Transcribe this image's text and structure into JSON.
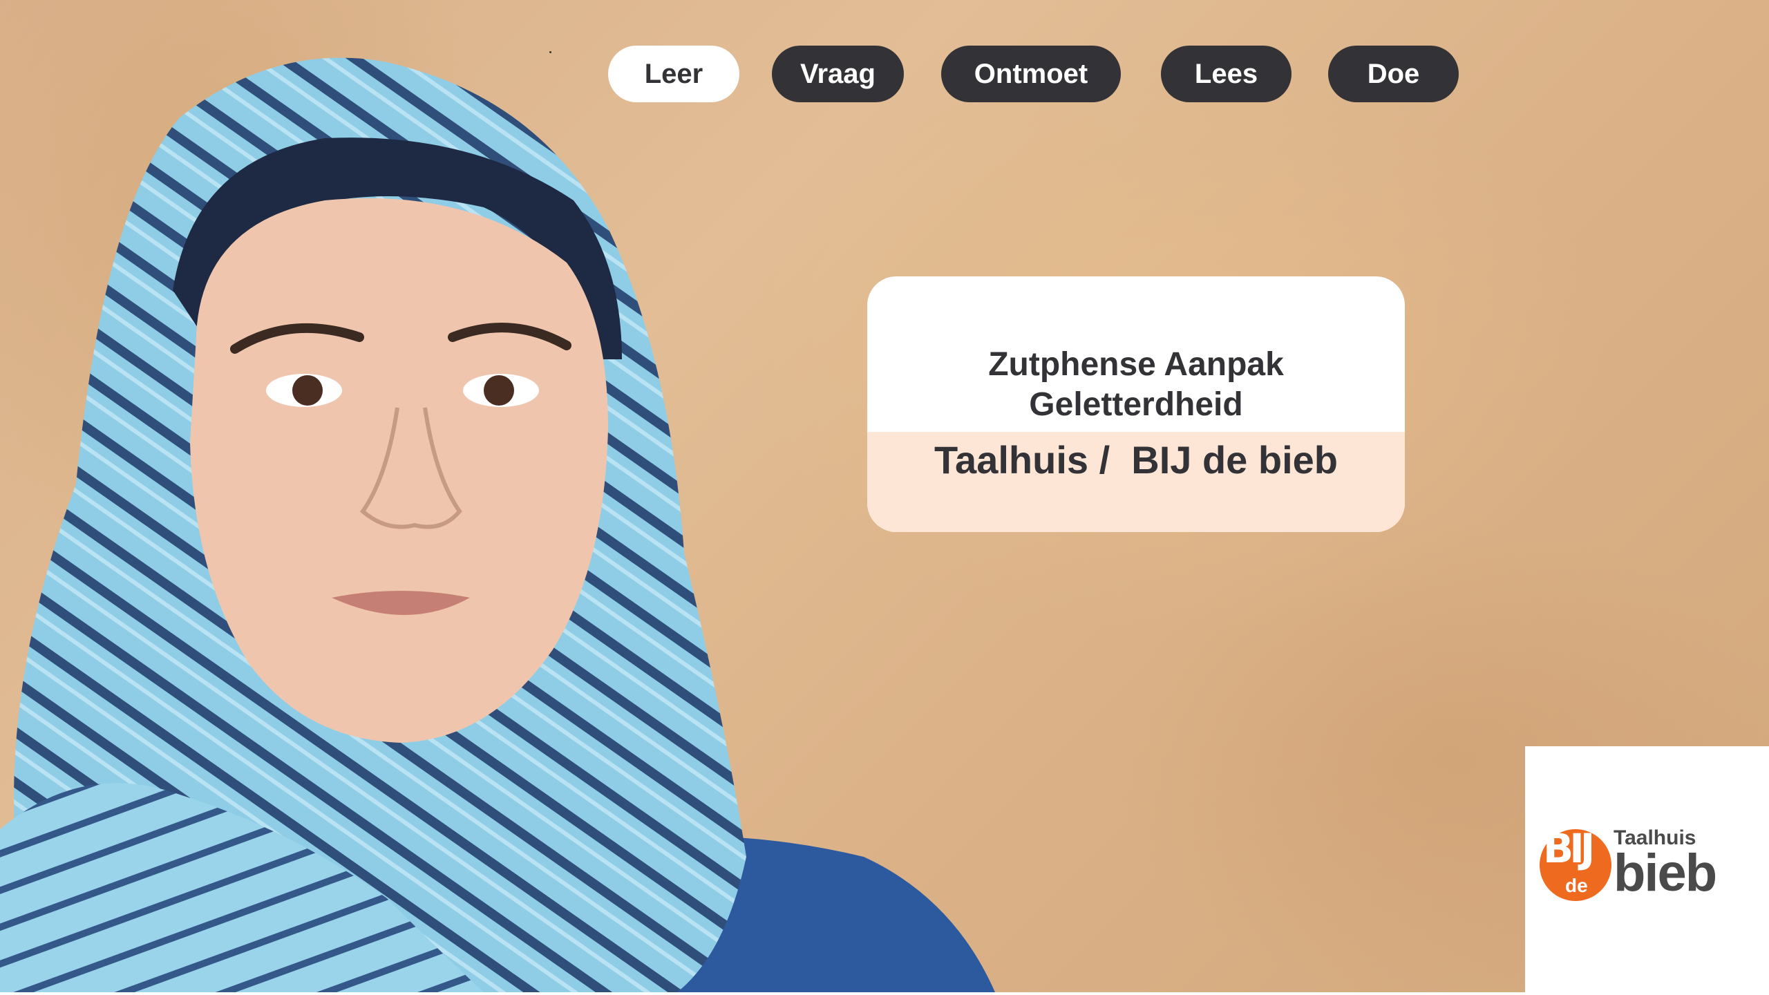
{
  "nav": {
    "items": [
      {
        "label": "Leer",
        "active": true
      },
      {
        "label": "Vraag",
        "active": false
      },
      {
        "label": "Ontmoet",
        "active": false
      },
      {
        "label": "Lees",
        "active": false
      },
      {
        "label": "Doe",
        "active": false
      }
    ]
  },
  "card": {
    "title_line1": "Zutphense Aanpak",
    "title_line2": "Geletterdheid",
    "subtitle": "Taalhuis /  BIJ de bieb"
  },
  "logo": {
    "bij": "BIJ",
    "de": "de",
    "taalhuis": "Taalhuis",
    "bieb": "bieb"
  },
  "colors": {
    "pill_dark": "#333337",
    "pill_active": "#ffffff",
    "card_accent": "#fde6d6",
    "logo_orange": "#ee6a1e",
    "background": "#dcb389"
  }
}
